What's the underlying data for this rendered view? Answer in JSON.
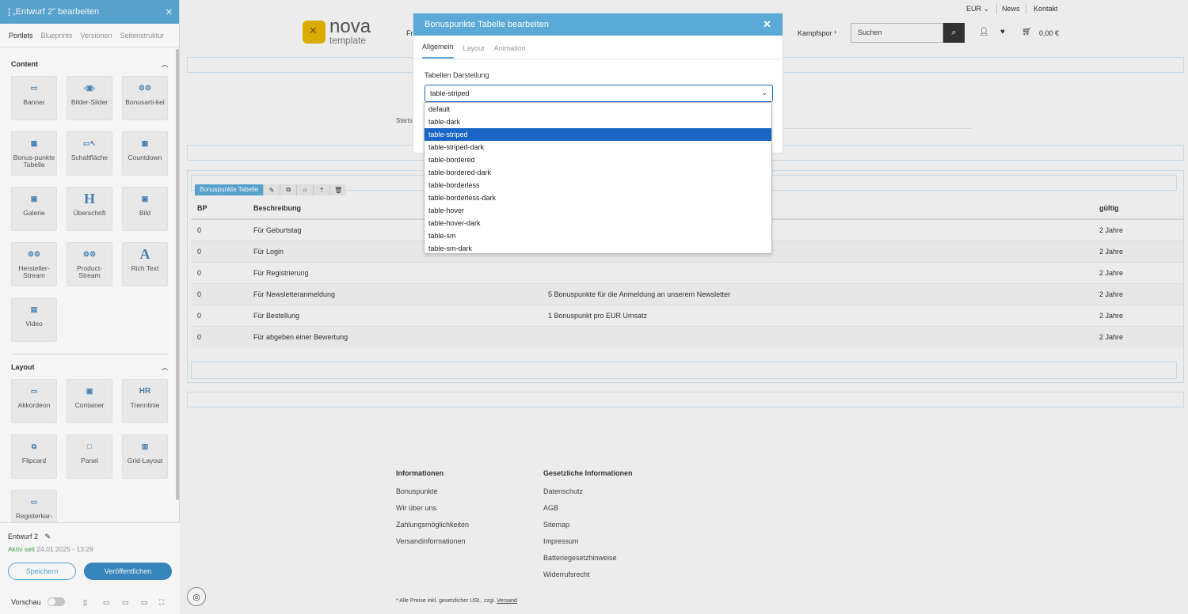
{
  "sidebar": {
    "title": "„Entwurf 2\" bearbeiten",
    "tabs": [
      "Portlets",
      "Blueprints",
      "Versionen",
      "Seitenstruktur"
    ],
    "content_heading": "Content",
    "content_items": [
      {
        "label": "Banner",
        "icon": "banner-icon"
      },
      {
        "label": "Bilder-Slider",
        "icon": "slider-icon"
      },
      {
        "label": "Bonusarti-kel",
        "icon": "bonus-article-icon"
      },
      {
        "label": "Bonus-punkte Tabelle",
        "icon": "table-icon"
      },
      {
        "label": "Schaltfläche",
        "icon": "cursor-icon"
      },
      {
        "label": "Countdown",
        "icon": "calendar-icon"
      },
      {
        "label": "Galerie",
        "icon": "gallery-icon"
      },
      {
        "label": "Überschrift",
        "icon": "heading-icon"
      },
      {
        "label": "Bild",
        "icon": "image-icon"
      },
      {
        "label": "Hersteller-Stream",
        "icon": "manufacturer-icon"
      },
      {
        "label": "Product-Stream",
        "icon": "product-icon"
      },
      {
        "label": "Rich Text",
        "icon": "richtext-icon"
      },
      {
        "label": "Video",
        "icon": "film-icon"
      }
    ],
    "layout_heading": "Layout",
    "layout_items": [
      {
        "label": "Akkordeon",
        "icon": "accordion-icon"
      },
      {
        "label": "Container",
        "icon": "container-icon"
      },
      {
        "label": "Trennlinie",
        "icon": "hr-icon"
      },
      {
        "label": "Flipcard",
        "icon": "flipcard-icon"
      },
      {
        "label": "Panel",
        "icon": "panel-icon"
      },
      {
        "label": "Grid-Layout",
        "icon": "grid-icon"
      },
      {
        "label": "Registerkar-",
        "icon": "tabs-icon"
      }
    ],
    "draft_name": "Entwurf 2",
    "status_label": "Aktiv seit",
    "status_date": "24.01.2025 - 13:29",
    "save_label": "Speichern",
    "publish_label": "Veröffentlichen",
    "preview_label": "Vorschau"
  },
  "header": {
    "currency": "EUR",
    "links": [
      "News",
      "Kontakt"
    ],
    "brand": "nova",
    "brand_sub": "template",
    "nav_first": "Fr",
    "nav_last": "Kampfspor",
    "search_placeholder": "Suchen",
    "cart_total": "0,00 €"
  },
  "page": {
    "start_label": "Starts",
    "portlet_tag": "Bonuspunkte Tabelle",
    "table": {
      "headers": [
        "BP",
        "Beschreibung",
        "",
        "gültig"
      ],
      "rows": [
        [
          "0",
          "Für Geburtstag",
          "",
          "2 Jahre"
        ],
        [
          "0",
          "Für Login",
          "",
          "2 Jahre"
        ],
        [
          "0",
          "Für Registrierung",
          "",
          "2 Jahre"
        ],
        [
          "0",
          "Für Newsletteranmeldung",
          "5 Bonuspunkte für die Anmeldung an unserem Newsletter",
          "2 Jahre"
        ],
        [
          "0",
          "Für Bestellung",
          "1 Bonuspunkt pro EUR Umsatz",
          "2 Jahre"
        ],
        [
          "0",
          "Für abgeben einer Bewertung",
          "",
          "2 Jahre"
        ]
      ]
    }
  },
  "footer": {
    "col1_heading": "Informationen",
    "col1_links": [
      "Bonuspunkte",
      "Wir über uns",
      "Zahlungsmöglichkeiten",
      "Versandinformationen"
    ],
    "col2_heading": "Gesetzliche Informationen",
    "col2_links": [
      "Datenschutz",
      "AGB",
      "Sitemap",
      "Impressum",
      "Batteriegesetzhinweise",
      "Widerrufsrecht"
    ],
    "note_text": "* Alle Preise inkl. gesetzlicher USt., zzgl.",
    "note_link": "Versand"
  },
  "modal": {
    "title": "Bonuspunkte Tabelle bearbeiten",
    "tabs": [
      "Allgemein",
      "Layout",
      "Animation"
    ],
    "field_label": "Tabellen Darstellung",
    "selected": "table-striped",
    "options": [
      "default",
      "table-dark",
      "table-striped",
      "table-striped-dark",
      "table-bordered",
      "table-bordered-dark",
      "table-borderless",
      "table-borderless-dark",
      "table-hover",
      "table-hover-dark",
      "table-sm",
      "table-sm-dark"
    ]
  },
  "colors": {
    "accent": "#5aa9d6",
    "primary": "#3a8bc4",
    "select_highlight": "#1a66c4",
    "logo": "#e3b400"
  }
}
